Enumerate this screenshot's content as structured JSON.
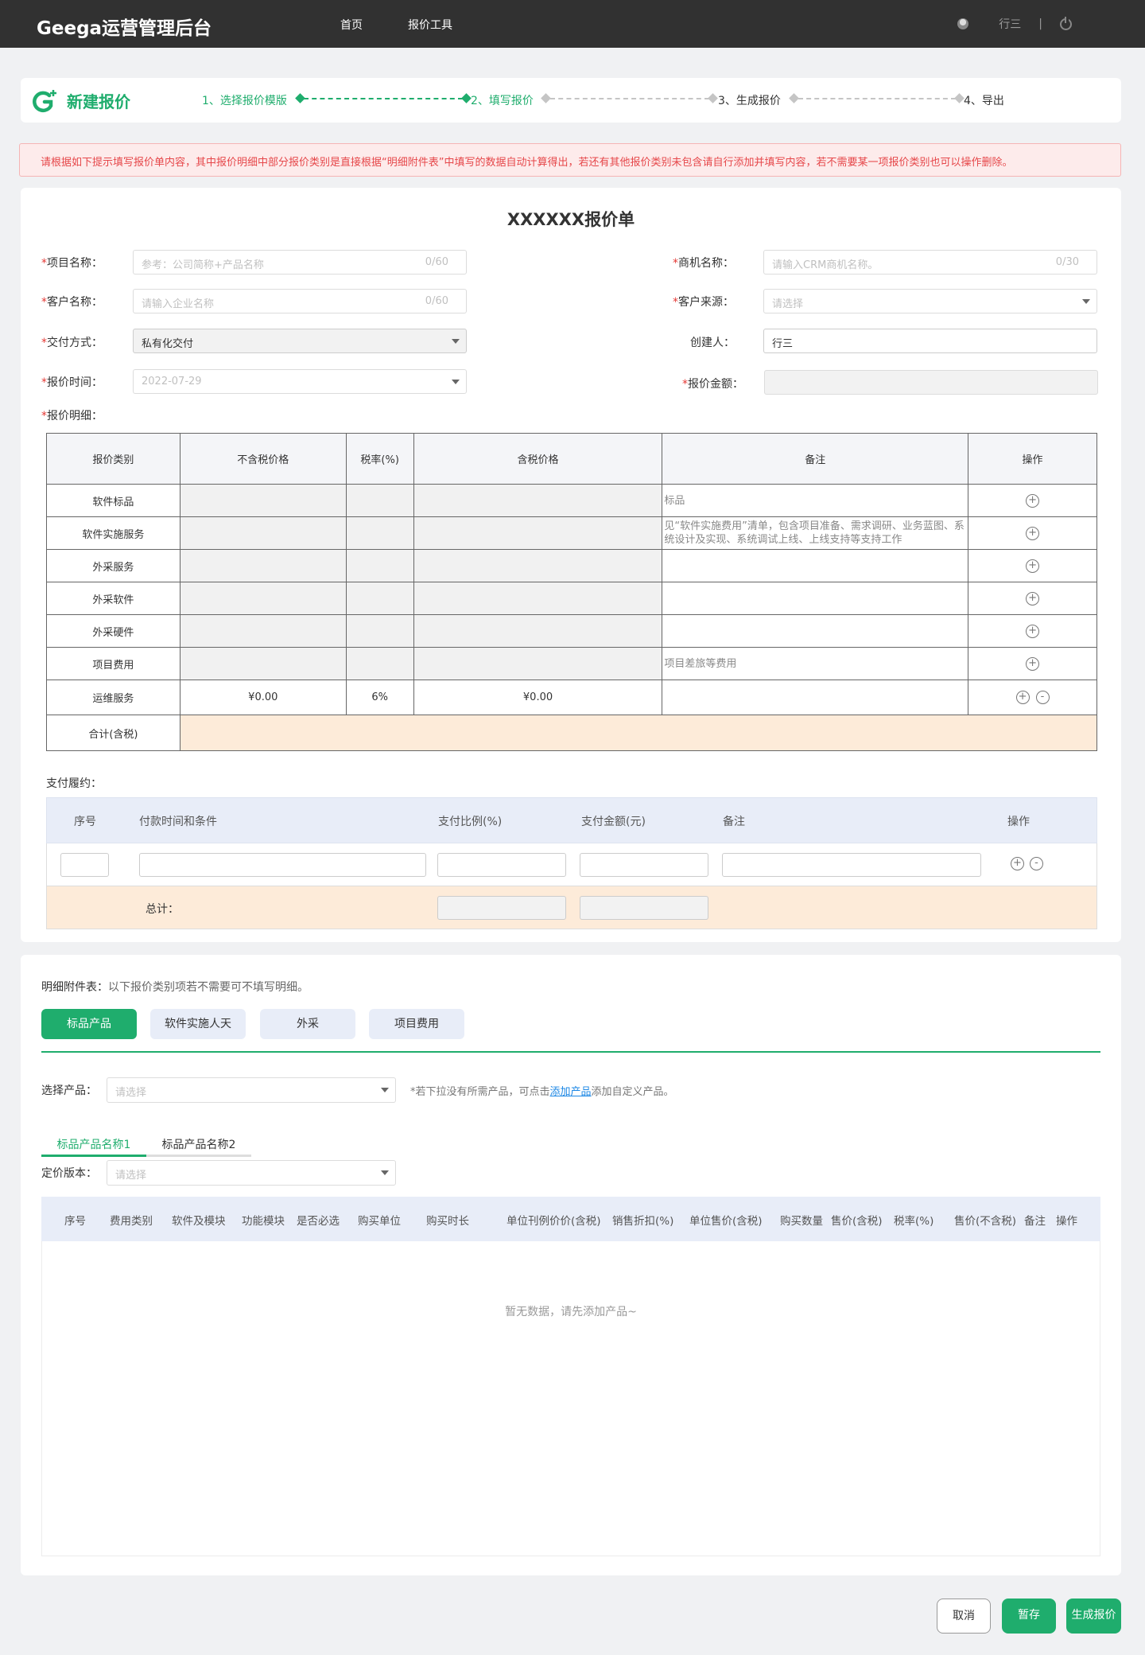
{
  "header": {
    "brand": "Geega运营管理后台",
    "nav": [
      "首页",
      "报价工具"
    ],
    "user_name": "行三",
    "separator": "|"
  },
  "steps": {
    "title": "新建报价",
    "items": [
      "1、选择报价模版",
      "2、填写报价",
      "3、生成报价",
      "4、导出"
    ],
    "current_index": 1
  },
  "alert": "请根据如下提示填写报价单内容，其中报价明细中部分报价类别是直接根据“明细附件表”中填写的数据自动计算得出，若还有其他报价类别未包含请自行添加并填写内容，若不需要某一项报价类别也可以操作删除。",
  "form": {
    "doc_title": "XXXXXX报价单",
    "project_name": {
      "label": "项目名称：",
      "placeholder": "参考：公司简称+产品名称",
      "counter": "0/60"
    },
    "opportunity_name": {
      "label": "商机名称：",
      "placeholder": "请输入CRM商机名称。",
      "counter": "0/30"
    },
    "customer_name": {
      "label": "客户名称：",
      "placeholder": "请输入企业名称",
      "counter": "0/60"
    },
    "customer_source": {
      "label": "客户来源：",
      "placeholder": "请选择"
    },
    "delivery": {
      "label": "交付方式：",
      "value": "私有化交付"
    },
    "creator": {
      "label": "创建人：",
      "value": "行三"
    },
    "quote_time": {
      "label": "报价时间：",
      "value": "2022-07-29"
    },
    "quote_amount": {
      "label": "报价金额：",
      "value": ""
    },
    "details_label": "报价明细："
  },
  "quote_table": {
    "headers": [
      "报价类别",
      "不含税价格",
      "税率(%)",
      "含税价格",
      "备注",
      "操作"
    ],
    "rows": [
      {
        "category": "软件标品",
        "pre_tax": "",
        "rate": "",
        "with_tax": "",
        "note": "标品",
        "ops": [
          "+"
        ]
      },
      {
        "category": "软件实施服务",
        "pre_tax": "",
        "rate": "",
        "with_tax": "",
        "note": "见“软件实施费用”清单，包含项目准备、需求调研、业务蓝图、系统设计及实现、系统调试上线、上线支持等支持工作",
        "ops": [
          "+"
        ]
      },
      {
        "category": "外采服务",
        "pre_tax": "",
        "rate": "",
        "with_tax": "",
        "note": "",
        "ops": [
          "+"
        ]
      },
      {
        "category": "外采软件",
        "pre_tax": "",
        "rate": "",
        "with_tax": "",
        "note": "",
        "ops": [
          "+"
        ]
      },
      {
        "category": "外采硬件",
        "pre_tax": "",
        "rate": "",
        "with_tax": "",
        "note": "",
        "ops": [
          "+"
        ]
      },
      {
        "category": "项目费用",
        "pre_tax": "",
        "rate": "",
        "with_tax": "",
        "note": "项目差旅等费用",
        "ops": [
          "+"
        ]
      },
      {
        "category": "运维服务",
        "pre_tax": "¥0.00",
        "rate": "6%",
        "with_tax": "¥0.00",
        "note": "",
        "ops": [
          "+",
          "-"
        ]
      }
    ],
    "total_label": "合计(含税)"
  },
  "payment": {
    "label": "支付履约：",
    "headers": [
      "序号",
      "付款时间和条件",
      "支付比例(%)",
      "支付金额(元)",
      "备注",
      "操作"
    ],
    "total_label": "总计："
  },
  "attachments": {
    "label": "明细附件表：",
    "hint": "以下报价类别项若不需要可不填写明细。",
    "tabs": [
      "标品产品",
      "软件实施人天",
      "外采",
      "项目费用"
    ],
    "select_product": {
      "label": "选择产品：",
      "placeholder": "请选择"
    },
    "note_prefix": "*若下拉没有所需产品，可点击",
    "note_link": "添加产品",
    "note_suffix": "添加自定义产品。",
    "subtabs": [
      "标品产品名称1",
      "标品产品名称2"
    ],
    "pricing_version": {
      "label": "定价版本：",
      "placeholder": "请选择"
    },
    "table_headers": [
      "序号",
      "费用类别",
      "软件及模块",
      "功能模块",
      "是否必选",
      "购买单位",
      "购买时长",
      "单位刊例价价(含税)",
      "销售折扣(%)",
      "单位售价(含税)",
      "购买数量",
      "售价(含税)",
      "税率(%)",
      "售价(不含税)",
      "备注",
      "操作"
    ],
    "empty_text": "暂无数据，请先添加产品~"
  },
  "footer": {
    "cancel": "取消",
    "save": "暂存",
    "generate": "生成报价"
  },
  "colors": {
    "accent": "#1fad6d",
    "alert_text": "#e6474a",
    "topbar": "#313131",
    "total_row": "#fdebd9"
  }
}
